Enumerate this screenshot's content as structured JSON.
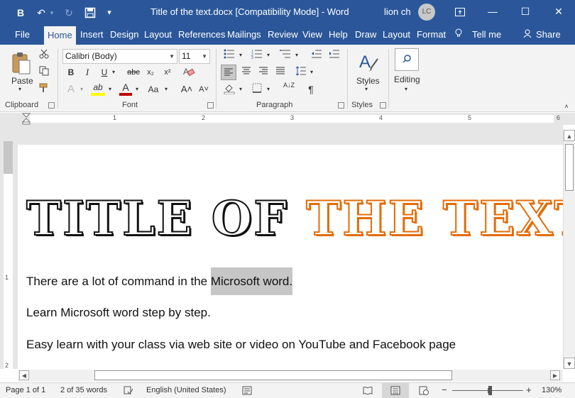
{
  "titlebar": {
    "quick_access": {
      "bold": "B",
      "undo": "↶",
      "redo": "↻",
      "save": "💾",
      "customize": "▾"
    },
    "doc_title": "Title of the text.docx [Compatibility Mode] - Word",
    "user_name": "lion ch",
    "user_initials": "LC",
    "window_buttons": {
      "restore_ribbon": "⇱",
      "minimize": "—",
      "maximize": "☐",
      "close": "✕"
    }
  },
  "tabs": [
    "File",
    "Home",
    "Insert",
    "Design",
    "Layout",
    "References",
    "Mailings",
    "Review",
    "View",
    "Help",
    "Draw",
    "Layout",
    "Format"
  ],
  "tell_me": "Tell me",
  "share": "Share",
  "ribbon": {
    "clipboard": {
      "paste": "Paste",
      "label": "Clipboard"
    },
    "font": {
      "font_name": "Calibri (Body)",
      "font_size": "11",
      "label": "Font",
      "buttons": {
        "bold": "B",
        "italic": "I",
        "underline": "U",
        "strike": "abc",
        "subscript": "x₂",
        "superscript": "x²",
        "text_effects": "A",
        "highlight": "ab",
        "font_color": "A",
        "change_case": "Aa",
        "grow": "A˄",
        "shrink": "A˅"
      }
    },
    "paragraph": {
      "label": "Paragraph",
      "sort": "A↓Z",
      "pilcrow": "¶"
    },
    "styles": {
      "button": "Styles",
      "label": "Styles"
    },
    "editing": {
      "button": "Editing"
    }
  },
  "ruler": {
    "numbers": [
      "1",
      "2",
      "3",
      "4",
      "5",
      "6"
    ]
  },
  "vruler": {
    "numbers": [
      "1",
      "2"
    ]
  },
  "document": {
    "title_part1": "TITLE OF",
    "title_part2": "THE TEXT",
    "para1_pre": "There are a lot of command in the ",
    "para1_sel": "Microsoft word.",
    "para2": "Learn Microsoft word step by step.",
    "para3": "Easy learn with your class via web site or video on YouTube and Facebook page"
  },
  "statusbar": {
    "page": "Page 1 of 1",
    "words": "2 of 35 words",
    "language": "English (United States)",
    "zoom_minus": "−",
    "zoom_plus": "+",
    "zoom": "130%"
  },
  "colors": {
    "accent": "#2b579a",
    "title_orange": "#e36c09"
  }
}
